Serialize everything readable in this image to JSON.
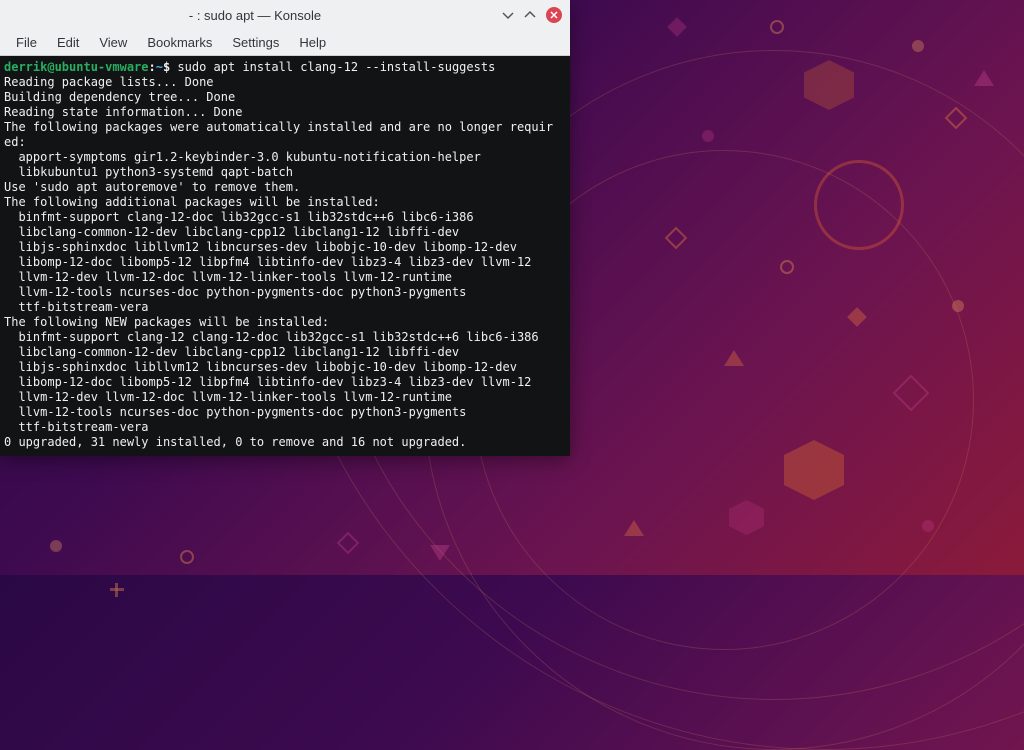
{
  "window": {
    "title": "- : sudo apt — Konsole"
  },
  "menubar": {
    "file": "File",
    "edit": "Edit",
    "view": "View",
    "bookmarks": "Bookmarks",
    "settings": "Settings",
    "help": "Help"
  },
  "prompt": {
    "user_host": "derrik@ubuntu-vmware",
    "colon": ":",
    "path": "~",
    "dollar": "$ ",
    "command": "sudo apt install clang-12 --install-suggests"
  },
  "terminal": {
    "lines": [
      "Reading package lists... Done",
      "Building dependency tree... Done",
      "Reading state information... Done",
      "The following packages were automatically installed and are no longer requir",
      "ed:",
      "  apport-symptoms gir1.2-keybinder-3.0 kubuntu-notification-helper",
      "  libkubuntu1 python3-systemd qapt-batch",
      "Use 'sudo apt autoremove' to remove them.",
      "The following additional packages will be installed:",
      "  binfmt-support clang-12-doc lib32gcc-s1 lib32stdc++6 libc6-i386",
      "  libclang-common-12-dev libclang-cpp12 libclang1-12 libffi-dev",
      "  libjs-sphinxdoc libllvm12 libncurses-dev libobjc-10-dev libomp-12-dev",
      "  libomp-12-doc libomp5-12 libpfm4 libtinfo-dev libz3-4 libz3-dev llvm-12",
      "  llvm-12-dev llvm-12-doc llvm-12-linker-tools llvm-12-runtime",
      "  llvm-12-tools ncurses-doc python-pygments-doc python3-pygments",
      "  ttf-bitstream-vera",
      "The following NEW packages will be installed:",
      "  binfmt-support clang-12 clang-12-doc lib32gcc-s1 lib32stdc++6 libc6-i386",
      "  libclang-common-12-dev libclang-cpp12 libclang1-12 libffi-dev",
      "  libjs-sphinxdoc libllvm12 libncurses-dev libobjc-10-dev libomp-12-dev",
      "  libomp-12-doc libomp5-12 libpfm4 libtinfo-dev libz3-4 libz3-dev llvm-12",
      "  llvm-12-dev llvm-12-doc llvm-12-linker-tools llvm-12-runtime",
      "  llvm-12-tools ncurses-doc python-pygments-doc python3-pygments",
      "  ttf-bitstream-vera",
      "0 upgraded, 31 newly installed, 0 to remove and 16 not upgraded."
    ]
  }
}
